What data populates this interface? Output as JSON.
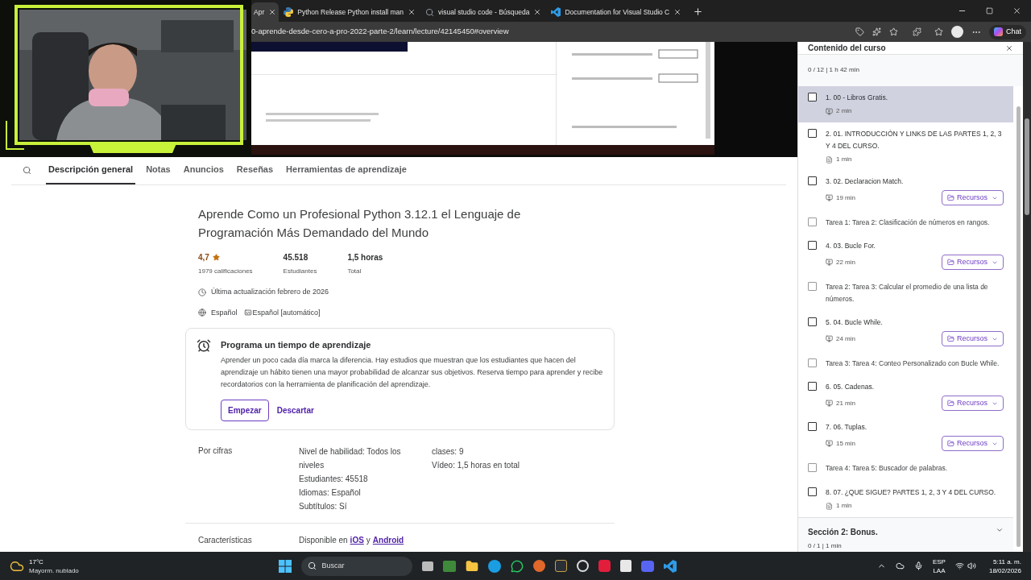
{
  "browser": {
    "tabs": [
      {
        "label": "Apr",
        "kind": "site",
        "selected": true
      },
      {
        "label": "Python Release Python install man",
        "kind": "python",
        "selected": false
      },
      {
        "label": "visual studio code - Búsqueda",
        "kind": "search",
        "selected": false
      },
      {
        "label": "Documentation for Visual Studio C",
        "kind": "code",
        "selected": false
      }
    ],
    "address": "0-aprende-desde-cero-a-pro-2022-parte-2/learn/lecture/42145450#overview",
    "chat_button": "Chat"
  },
  "course_tabs": [
    {
      "label": "Descripción general",
      "selected": true
    },
    {
      "label": "Notas",
      "selected": false
    },
    {
      "label": "Anuncios",
      "selected": false
    },
    {
      "label": "Reseñas",
      "selected": false
    },
    {
      "label": "Herramientas de aprendizaje",
      "selected": false
    }
  ],
  "course": {
    "title": "Aprende Como un Profesional Python 3.12.1 el Lenguaje de Programación Más Demandado del Mundo",
    "rating": "4,7",
    "ratings_count": "1979 calificaciones",
    "stats": [
      {
        "value": "45.518",
        "label": "Estudiantes"
      },
      {
        "value": "1,5 horas",
        "label": "Total"
      }
    ],
    "updated": "Última actualización febrero de 2026",
    "language": "Español",
    "captions": "Español [automático]"
  },
  "reminder": {
    "title": "Programa un tiempo de aprendizaje",
    "body": "Aprender un poco cada día marca la diferencia. Hay estudios que muestran que los estudiantes que hacen del aprendizaje un hábito tienen una mayor probabilidad de alcanzar sus objetivos. Reserva tiempo para aprender y recibe recordatorios con la herramienta de planificación del aprendizaje.",
    "primary_button": "Empezar",
    "secondary_button": "Descartar"
  },
  "by_numbers": {
    "label": "Por cifras",
    "column_1": [
      "Nivel de habilidad: Todos los niveles",
      "Estudiantes: 45518",
      "Idiomas: Español",
      "Subtítulos: Sí"
    ],
    "column_2": [
      "clases: 9",
      "Vídeo: 1,5 horas en total"
    ]
  },
  "features": {
    "label": "Características",
    "prefix": "Disponible en",
    "joiner": "y",
    "links": [
      "iOS",
      "Android"
    ]
  },
  "sidebar": {
    "title": "Contenido del curso",
    "progress": "0 / 12 | 1 h 42 min",
    "items": [
      {
        "kind": "lecture",
        "title": "1. 00 - Libros Gratis.",
        "duration": {
          "kind": "video",
          "text": "2 min"
        },
        "selected": true,
        "checked": false
      },
      {
        "kind": "lecture",
        "title": "2. 01. INTRODUCCIÓN Y LINKS DE LAS PARTES 1, 2, 3 Y 4 DEL CURSO.",
        "duration": {
          "kind": "article",
          "text": "1 min"
        },
        "selected": false,
        "checked": false
      },
      {
        "kind": "lecture",
        "title": "3. 02. Declaracion Match.",
        "duration": {
          "kind": "video",
          "text": "19 min"
        },
        "resources": "Recursos",
        "selected": false,
        "checked": false
      },
      {
        "kind": "task",
        "title": "Tarea 1: Tarea 2: Clasificación de números en rangos.",
        "selected": false,
        "checked": false
      },
      {
        "kind": "lecture",
        "title": "4. 03. Bucle For.",
        "duration": {
          "kind": "video",
          "text": "22 min"
        },
        "resources": "Recursos",
        "selected": false,
        "checked": false
      },
      {
        "kind": "task",
        "title": "Tarea 2: Tarea 3: Calcular el promedio de una lista de números.",
        "selected": false,
        "checked": false
      },
      {
        "kind": "lecture",
        "title": "5. 04. Bucle While.",
        "duration": {
          "kind": "video",
          "text": "24 min"
        },
        "resources": "Recursos",
        "selected": false,
        "checked": false
      },
      {
        "kind": "task",
        "title": "Tarea 3: Tarea 4: Conteo Personalizado con Bucle While.",
        "selected": false,
        "checked": false
      },
      {
        "kind": "lecture",
        "title": "6. 05. Cadenas.",
        "duration": {
          "kind": "video",
          "text": "21 min"
        },
        "resources": "Recursos",
        "selected": false,
        "checked": false
      },
      {
        "kind": "lecture",
        "title": "7. 06. Tuplas.",
        "duration": {
          "kind": "video",
          "text": "15 min"
        },
        "resources": "Recursos",
        "selected": false,
        "checked": false
      },
      {
        "kind": "task",
        "title": "Tarea 4: Tarea 5: Buscador de palabras.",
        "selected": false,
        "checked": false
      },
      {
        "kind": "lecture",
        "title": "8. 07. ¿QUE SIGUE? PARTES 1, 2, 3 Y 4 DEL CURSO.",
        "duration": {
          "kind": "article",
          "text": "1 min"
        },
        "selected": false,
        "checked": false
      }
    ],
    "next_section": {
      "title": "Sección 2: Bonus.",
      "progress": "0 / 1 | 1 min",
      "expanded": false
    }
  },
  "taskbar": {
    "temperature": "17°C",
    "weather": "Mayorm. nublado",
    "search_placeholder": "Buscar",
    "language": "ESP",
    "layout": "LAA",
    "time": "5:11 a. m.",
    "date": "18/02/2026"
  }
}
